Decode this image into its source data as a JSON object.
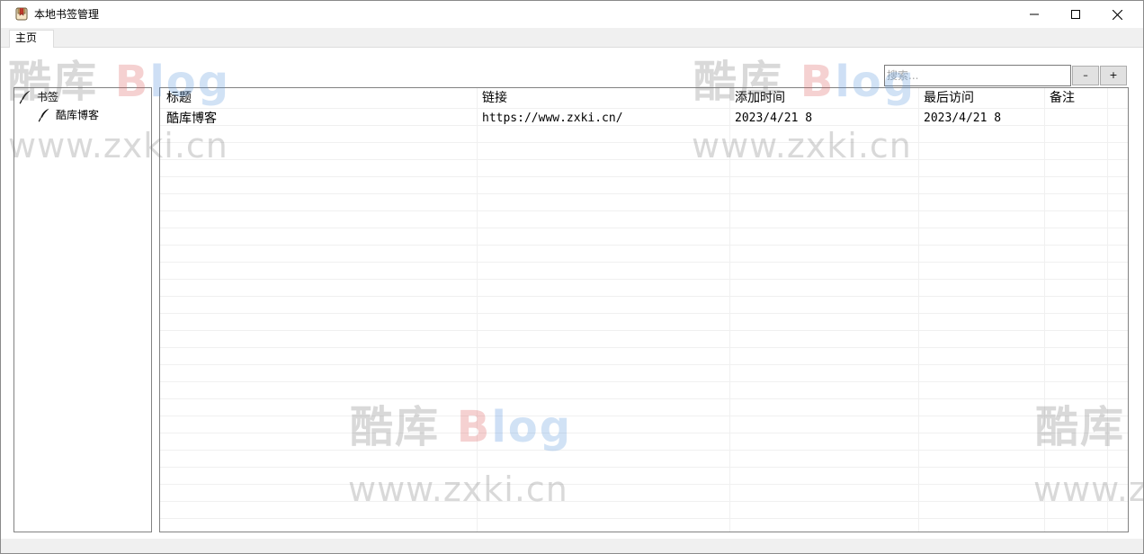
{
  "window": {
    "title": "本地书签管理"
  },
  "tabs": [
    {
      "label": "主页"
    }
  ],
  "search": {
    "placeholder": "搜索...",
    "value": ""
  },
  "buttons": {
    "remove_label": "–",
    "add_label": "+"
  },
  "tree": {
    "root": {
      "label": "书签",
      "icon": "feather-icon"
    },
    "children": [
      {
        "label": "酷库博客",
        "icon": "feather-icon"
      }
    ]
  },
  "table": {
    "columns": [
      "标题",
      "链接",
      "添加时间",
      "最后访问",
      "备注"
    ],
    "rows": [
      {
        "title": "酷库博客",
        "url": "https://www.zxki.cn/",
        "added": "2023/4/21 8",
        "last_visit": "2023/4/21 8",
        "note": ""
      }
    ]
  },
  "watermark": {
    "logo_cn": "酷库",
    "logo_b": "B",
    "logo_l": "l",
    "logo_og": "og",
    "url": "www.zxki.cn"
  }
}
